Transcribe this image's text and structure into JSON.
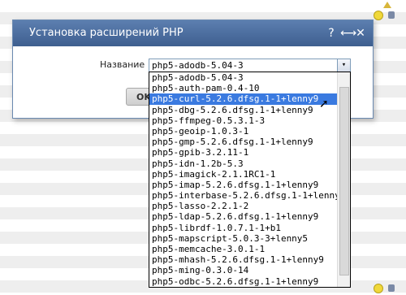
{
  "dialog": {
    "title": "Установка расширений PHP",
    "help_glyph": "?",
    "resize_glyph": "⟷",
    "close_glyph": "✕"
  },
  "form": {
    "name_label": "Название",
    "selected_value": "php5-adodb-5.04-3",
    "arrow_glyph": "▾",
    "ok_label": "OK"
  },
  "dropdown": {
    "highlighted_index": 2,
    "options": [
      "php5-adodb-5.04-3",
      "php5-auth-pam-0.4-10",
      "php5-curl-5.2.6.dfsg.1-1+lenny9",
      "php5-dbg-5.2.6.dfsg.1-1+lenny9",
      "php5-ffmpeg-0.5.3.1-3",
      "php5-geoip-1.0.3-1",
      "php5-gmp-5.2.6.dfsg.1-1+lenny9",
      "php5-gpib-3.2.11-1",
      "php5-idn-1.2b-5.3",
      "php5-imagick-2.1.1RC1-1",
      "php5-imap-5.2.6.dfsg.1-1+lenny9",
      "php5-interbase-5.2.6.dfsg.1-1+lenny9",
      "php5-lasso-2.2.1-2",
      "php5-ldap-5.2.6.dfsg.1-1+lenny9",
      "php5-librdf-1.0.7.1-1+b1",
      "php5-mapscript-5.0.3-3+lenny5",
      "php5-memcache-3.0.1-1",
      "php5-mhash-5.2.6.dfsg.1-1+lenny9",
      "php5-ming-0.3.0-14",
      "php5-odbc-5.2.6.dfsg.1-1+lenny9"
    ]
  },
  "colors": {
    "titlebar": "#4a6ea0",
    "highlight": "#3a7ae0"
  }
}
